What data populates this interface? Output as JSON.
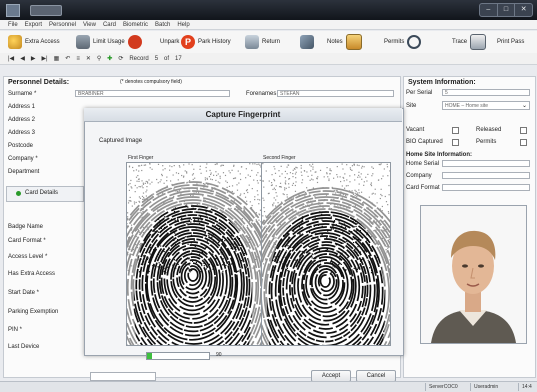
{
  "window": {
    "title": "",
    "controls": [
      "–",
      "□",
      "✕"
    ]
  },
  "menu": [
    "File",
    "Export",
    "Personnel",
    "View",
    "Card",
    "Biometric",
    "Batch",
    "Help"
  ],
  "toolbar": {
    "extra_access": "Extra Access",
    "limit_usage": "Limit Usage",
    "unpark": "Unpark",
    "park_history": "Park History",
    "return": "Return",
    "notes": "Notes",
    "permits": "Permits",
    "trace": "Trace",
    "print_pass": "Print Pass"
  },
  "navbar": {
    "record_label": "Record",
    "record_value": "5",
    "of_label": "of",
    "total": "17"
  },
  "personnel": {
    "heading": "Personnel Details:",
    "note": "(* denotes compulsory field)",
    "surname_label": "Surname *",
    "surname_value": "BRABINER",
    "forenames_label": "Forenames",
    "forenames_value": "STEFAN",
    "fields": [
      "Address 1",
      "Address 2",
      "Address 3",
      "Postcode",
      "Company *",
      "Department"
    ],
    "card_details": "Card Details",
    "card_fields": [
      "Badge Name",
      "Card Format *",
      "Access Level *",
      "Has Extra Access",
      "Start Date *",
      "Parking Exemption",
      "PIN *",
      "Last Device"
    ]
  },
  "system": {
    "heading": "System Information:",
    "per_serial_label": "Per Serial",
    "per_serial_value": "5",
    "site_label": "Site",
    "site_value": "HOME – Home site",
    "checks": [
      {
        "label": "Vacant",
        "checked": false
      },
      {
        "label": "Released",
        "checked": false
      },
      {
        "label": "BIO Captured",
        "checked": false
      },
      {
        "label": "Permits",
        "checked": false
      }
    ],
    "home_site_heading": "Home Site Information:",
    "home_serial_label": "Home Serial",
    "company_label": "Company",
    "card_format_label": "Card Format"
  },
  "modal": {
    "title": "Capture Fingerprint",
    "captured_label": "Captured Image",
    "first_finger": "First Finger",
    "second_finger": "Second Finger",
    "quality_value": "90",
    "quality_fraction": 0.08,
    "accept": "Accept",
    "cancel": "Cancel"
  },
  "status": {
    "server": "ServerCOC0",
    "user": "Useradmin",
    "time": "14:4"
  },
  "colors": {
    "accent_red": "#d23a1e",
    "titlebar": "#1b2028",
    "progress_green": "#3fbf3f"
  }
}
